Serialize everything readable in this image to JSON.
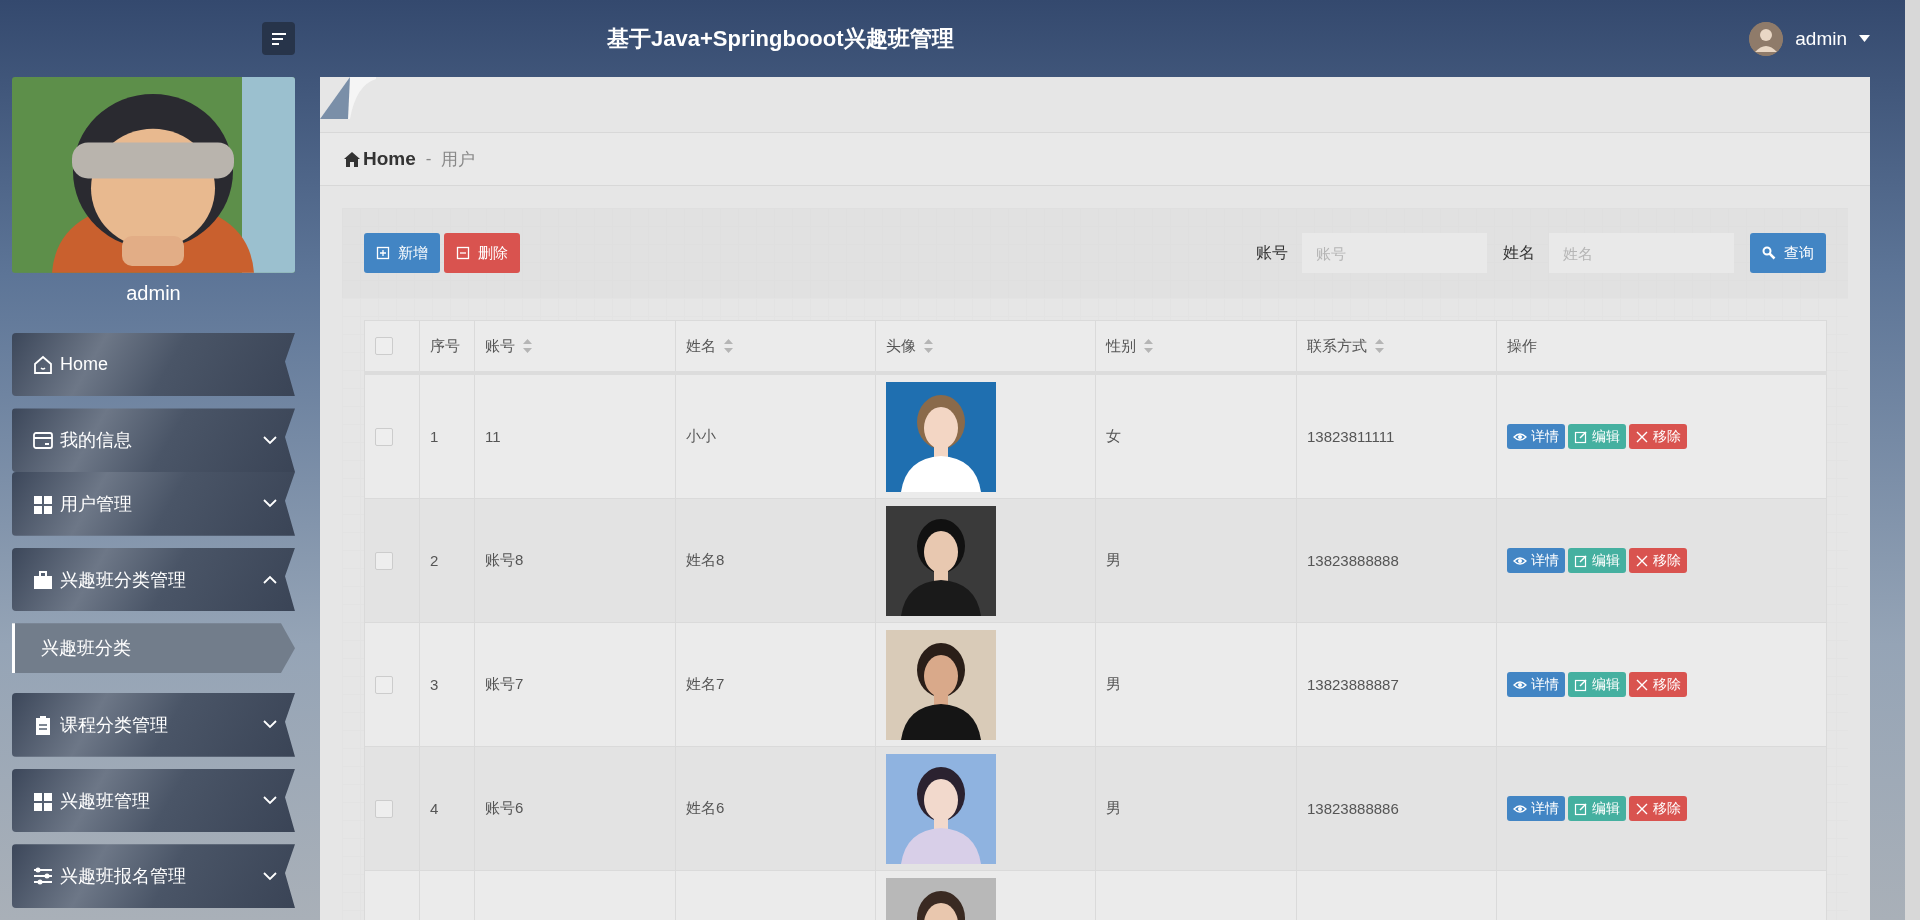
{
  "header": {
    "title": "基于Java+Springbooot兴趣班管理",
    "user": "admin"
  },
  "sidebar": {
    "username": "admin",
    "items": [
      {
        "label": "Home",
        "kind": "home"
      },
      {
        "label": "我的信息",
        "kind": "card",
        "expanded": false
      },
      {
        "label": "用户管理",
        "kind": "grid",
        "expanded": false
      },
      {
        "label": "兴趣班分类管理",
        "kind": "briefcase",
        "expanded": true,
        "children": [
          {
            "label": "兴趣班分类",
            "selected": true
          }
        ]
      },
      {
        "label": "课程分类管理",
        "kind": "clipboard",
        "expanded": false
      },
      {
        "label": "兴趣班管理",
        "kind": "grid",
        "expanded": false
      },
      {
        "label": "兴趣班报名管理",
        "kind": "sliders",
        "expanded": false
      }
    ]
  },
  "breadcrumb": {
    "home": "Home",
    "separator": "-",
    "current": "用户"
  },
  "toolbar": {
    "buttons": [
      {
        "label": "新增",
        "kind": "add"
      },
      {
        "label": "删除",
        "kind": "delete"
      }
    ],
    "filters": [
      {
        "label": "账号",
        "placeholder": "账号"
      },
      {
        "label": "姓名",
        "placeholder": "姓名"
      }
    ],
    "search": "查询"
  },
  "table": {
    "header_checked": false,
    "columns": [
      {
        "label": "序号",
        "sortable": false
      },
      {
        "label": "账号",
        "sortable": true
      },
      {
        "label": "姓名",
        "sortable": true
      },
      {
        "label": "头像",
        "sortable": true
      },
      {
        "label": "性别",
        "sortable": true
      },
      {
        "label": "联系方式",
        "sortable": true
      },
      {
        "label": "操作",
        "sortable": false
      }
    ],
    "rows": [
      {
        "checked": false,
        "no": "1",
        "account": "11",
        "name": "小小",
        "avatar": {
          "kind": "picture"
        },
        "gender": "女",
        "phone": "13823811111",
        "actions": [
          {
            "label": "详情",
            "kind": "view"
          },
          {
            "label": "编辑",
            "kind": "edit"
          },
          {
            "label": "移除",
            "kind": "remove"
          }
        ]
      },
      {
        "checked": false,
        "no": "2",
        "account": "账号8",
        "name": "姓名8",
        "avatar": {
          "kind": "picture"
        },
        "gender": "男",
        "phone": "13823888888",
        "actions": [
          {
            "label": "详情",
            "kind": "view"
          },
          {
            "label": "编辑",
            "kind": "edit"
          },
          {
            "label": "移除",
            "kind": "remove"
          }
        ]
      },
      {
        "checked": false,
        "no": "3",
        "account": "账号7",
        "name": "姓名7",
        "avatar": {
          "kind": "picture"
        },
        "gender": "男",
        "phone": "13823888887",
        "actions": [
          {
            "label": "详情",
            "kind": "view"
          },
          {
            "label": "编辑",
            "kind": "edit"
          },
          {
            "label": "移除",
            "kind": "remove"
          }
        ]
      },
      {
        "checked": false,
        "no": "4",
        "account": "账号6",
        "name": "姓名6",
        "avatar": {
          "kind": "picture"
        },
        "gender": "男",
        "phone": "13823888886",
        "actions": [
          {
            "label": "详情",
            "kind": "view"
          },
          {
            "label": "编辑",
            "kind": "edit"
          },
          {
            "label": "移除",
            "kind": "remove"
          }
        ]
      },
      {
        "avatar": {
          "kind": "picture"
        }
      }
    ]
  }
}
